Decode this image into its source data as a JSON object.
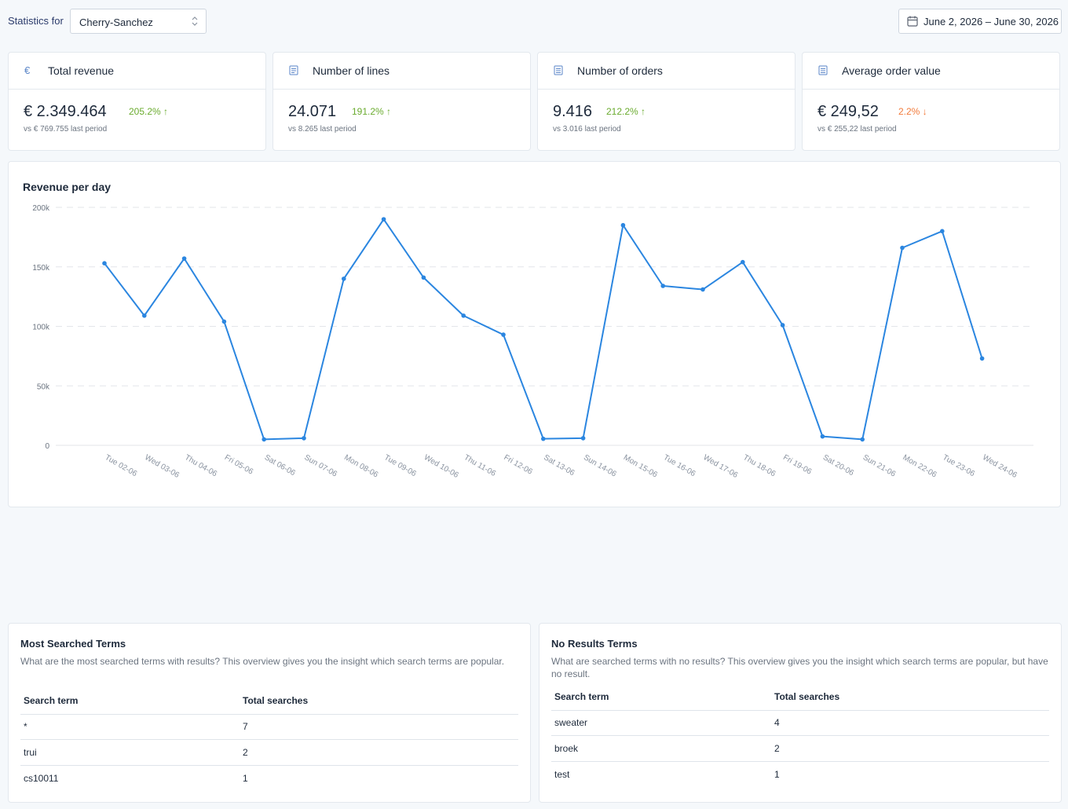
{
  "header": {
    "statistics_for_label": "Statistics for",
    "store": "Cherry-Sanchez",
    "date_range": "June 2, 2026 – June 30, 2026"
  },
  "kpis": [
    {
      "title": "Total revenue",
      "icon": "euro-icon",
      "value": "€ 2.349.464",
      "change": "205.2% ↑",
      "trend": "up",
      "previous": "vs € 769.755 last period"
    },
    {
      "title": "Number of lines",
      "icon": "list-icon",
      "value": "24.071",
      "change": "191.2% ↑",
      "trend": "up",
      "previous": "vs 8.265 last period"
    },
    {
      "title": "Number of orders",
      "icon": "receipt-icon",
      "value": "9.416",
      "change": "212.2% ↑",
      "trend": "up",
      "previous": "vs 3.016 last period"
    },
    {
      "title": "Average order value",
      "icon": "receipt-icon",
      "value": "€ 249,52",
      "change": "2.2% ↓",
      "trend": "down",
      "previous": "vs € 255,22 last period"
    }
  ],
  "colors": {
    "up": "#6aab2e",
    "down": "#f27a3a",
    "line": "#2b86e0"
  },
  "chart_data": {
    "type": "line",
    "title": "Revenue per day",
    "categories": [
      "Tue 02-06",
      "Wed 03-06",
      "Thu 04-06",
      "Fri 05-06",
      "Sat 06-06",
      "Sun 07-06",
      "Mon 08-06",
      "Tue 09-06",
      "Wed 10-06",
      "Thu 11-06",
      "Fri 12-06",
      "Sat 13-06",
      "Sun 14-06",
      "Mon 15-06",
      "Tue 16-06",
      "Wed 17-06",
      "Thu 18-06",
      "Fri 19-06",
      "Sat 20-06",
      "Sun 21-06",
      "Mon 22-06",
      "Tue 23-06",
      "Wed 24-06"
    ],
    "series": [
      {
        "values": [
          153000,
          109000,
          157000,
          104000,
          5000,
          6000,
          140000,
          190000,
          141000,
          109000,
          93000,
          5500,
          6000,
          185000,
          134000,
          131000,
          154000,
          101000,
          7500,
          5000,
          166000,
          180000,
          73000
        ]
      }
    ],
    "yticks": [
      "0",
      "50k",
      "100k",
      "150k",
      "200k"
    ],
    "ylim": [
      0,
      200000
    ],
    "grid": true
  },
  "most_searched": {
    "title": "Most Searched Terms",
    "description": "What are the most searched terms with results? This overview gives you the insight which search terms are popular.",
    "columns": [
      "Search term",
      "Total searches"
    ],
    "rows": [
      [
        "*",
        "7"
      ],
      [
        "trui",
        "2"
      ],
      [
        "cs10011",
        "1"
      ]
    ]
  },
  "no_results": {
    "title": "No Results Terms",
    "description": "What are searched terms with no results? This overview gives you the insight which search terms are popular, but have no result.",
    "columns": [
      "Search term",
      "Total searches"
    ],
    "rows": [
      [
        "sweater",
        "4"
      ],
      [
        "broek",
        "2"
      ],
      [
        "test",
        "1"
      ]
    ]
  }
}
